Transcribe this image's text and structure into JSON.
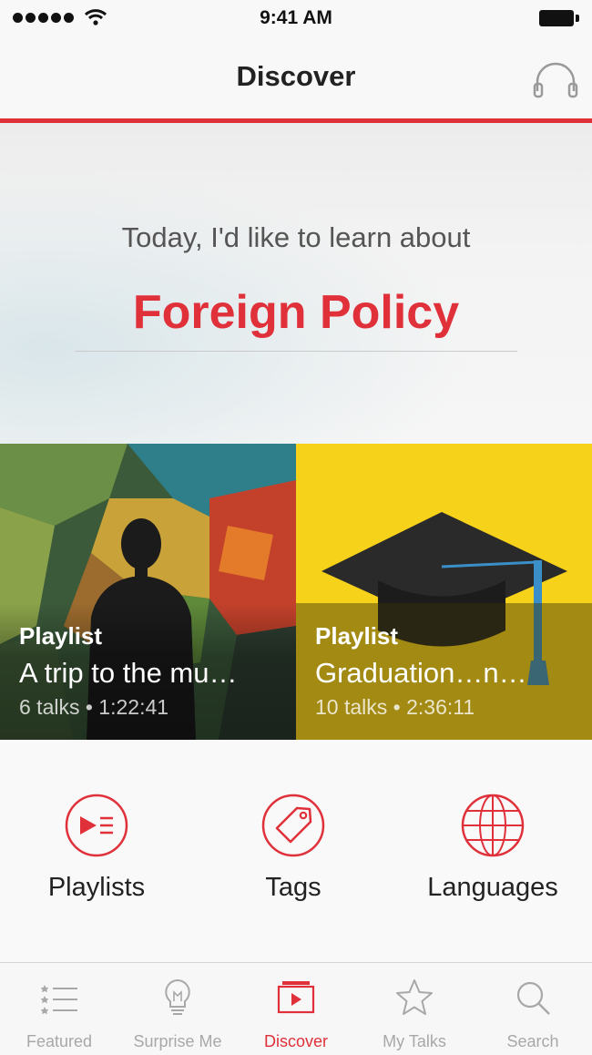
{
  "status_bar": {
    "time": "9:41 AM"
  },
  "nav": {
    "title": "Discover"
  },
  "hero": {
    "prompt": "Today, I'd like to learn about",
    "topic": "Foreign Policy"
  },
  "tiles": [
    {
      "kind": "Playlist",
      "title": "A trip to the mu…",
      "meta": "6 talks • 1:22:41"
    },
    {
      "kind": "Playlist",
      "title": "Graduation…n…",
      "meta": "10 talks • 2:36:11"
    }
  ],
  "categories": [
    {
      "label": "Playlists",
      "icon": "playlist-icon"
    },
    {
      "label": "Tags",
      "icon": "tag-icon"
    },
    {
      "label": "Languages",
      "icon": "globe-icon"
    }
  ],
  "tabs": [
    {
      "label": "Featured",
      "icon": "featured-list-icon",
      "active": false
    },
    {
      "label": "Surprise Me",
      "icon": "lightbulb-icon",
      "active": false
    },
    {
      "label": "Discover",
      "icon": "discover-play-icon",
      "active": true
    },
    {
      "label": "My Talks",
      "icon": "star-icon",
      "active": false
    },
    {
      "label": "Search",
      "icon": "search-icon",
      "active": false
    }
  ],
  "colors": {
    "accent": "#e0313b",
    "tile_yellow": "#f6d21a",
    "inactive": "#a8a8a8"
  }
}
